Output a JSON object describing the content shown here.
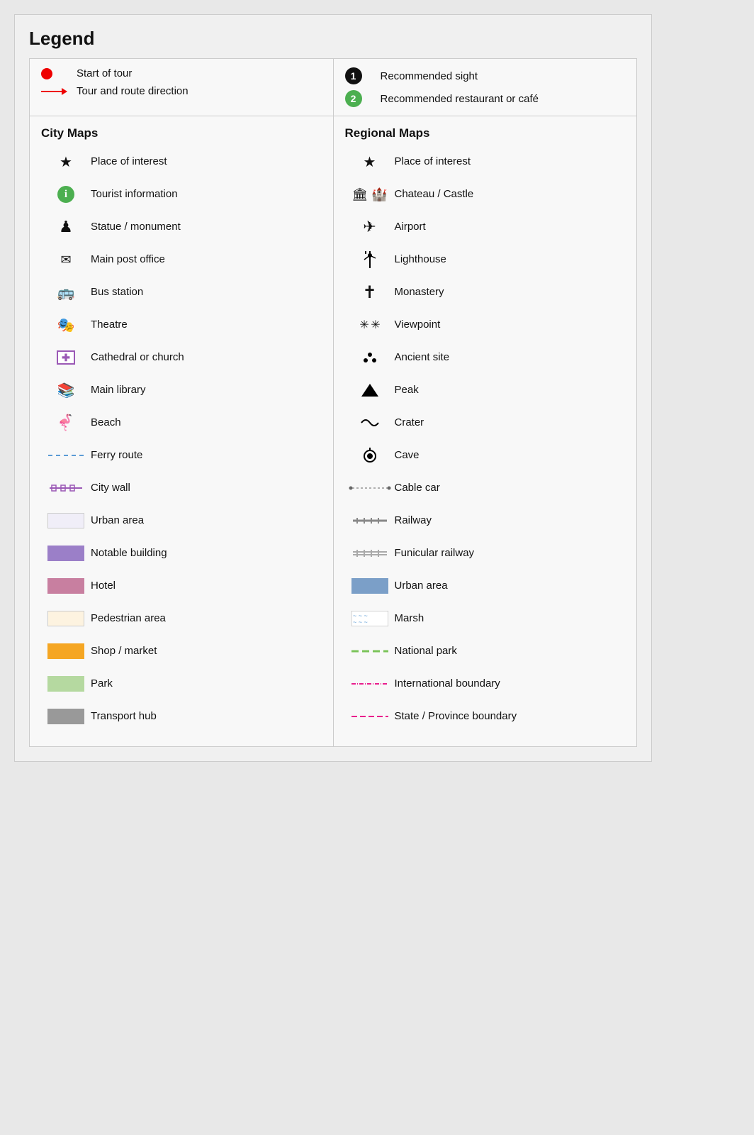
{
  "title": "Legend",
  "top": {
    "left": [
      {
        "icon": "red-dot",
        "label": "Start of tour"
      },
      {
        "icon": "red-arrow",
        "label": "Tour and route direction"
      }
    ],
    "right": [
      {
        "icon": "circle-1",
        "label": "Recommended sight"
      },
      {
        "icon": "circle-2",
        "label": "Recommended restaurant or café"
      }
    ]
  },
  "city_maps": {
    "heading": "City Maps",
    "items": [
      {
        "icon": "star",
        "label": "Place of interest"
      },
      {
        "icon": "info",
        "label": "Tourist information"
      },
      {
        "icon": "statue",
        "label": "Statue / monument"
      },
      {
        "icon": "post",
        "label": "Main post office"
      },
      {
        "icon": "bus",
        "label": "Bus station"
      },
      {
        "icon": "theatre",
        "label": "Theatre"
      },
      {
        "icon": "church",
        "label": "Cathedral or church"
      },
      {
        "icon": "library",
        "label": "Main library"
      },
      {
        "icon": "beach",
        "label": "Beach"
      },
      {
        "icon": "ferry",
        "label": "Ferry route"
      },
      {
        "icon": "citywall",
        "label": "City wall"
      },
      {
        "icon": "urban-left",
        "label": "Urban area"
      },
      {
        "icon": "notable",
        "label": "Notable building"
      },
      {
        "icon": "hotel",
        "label": "Hotel"
      },
      {
        "icon": "pedestrian",
        "label": "Pedestrian area"
      },
      {
        "icon": "shop",
        "label": "Shop / market"
      },
      {
        "icon": "park",
        "label": "Park"
      },
      {
        "icon": "transport",
        "label": "Transport hub"
      }
    ]
  },
  "regional_maps": {
    "heading": "Regional Maps",
    "items": [
      {
        "icon": "star",
        "label": "Place of interest"
      },
      {
        "icon": "castle",
        "label": "Chateau / Castle"
      },
      {
        "icon": "airport",
        "label": "Airport"
      },
      {
        "icon": "lighthouse",
        "label": "Lighthouse"
      },
      {
        "icon": "monastery",
        "label": "Monastery"
      },
      {
        "icon": "viewpoint",
        "label": "Viewpoint"
      },
      {
        "icon": "ancient",
        "label": "Ancient site"
      },
      {
        "icon": "peak",
        "label": "Peak"
      },
      {
        "icon": "crater",
        "label": "Crater"
      },
      {
        "icon": "cave",
        "label": "Cave"
      },
      {
        "icon": "cablecar",
        "label": "Cable car"
      },
      {
        "icon": "railway",
        "label": "Railway"
      },
      {
        "icon": "funicular",
        "label": "Funicular railway"
      },
      {
        "icon": "urban-right",
        "label": "Urban area"
      },
      {
        "icon": "marsh",
        "label": "Marsh"
      },
      {
        "icon": "national-park",
        "label": "National park"
      },
      {
        "icon": "intl-boundary",
        "label": "International boundary"
      },
      {
        "icon": "state-boundary",
        "label": "State / Province boundary"
      }
    ]
  }
}
